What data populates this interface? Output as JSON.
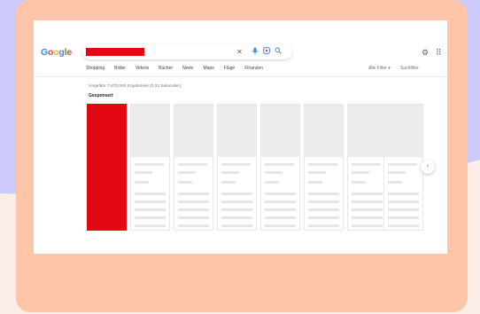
{
  "logo": {
    "letters": [
      "G",
      "o",
      "o",
      "g",
      "l",
      "e"
    ],
    "colors": [
      "#4285f4",
      "#ea4335",
      "#fbbc05",
      "#4285f4",
      "#34a853",
      "#ea4335"
    ]
  },
  "search": {
    "clear_icon": "close-icon",
    "mic_icon": "mic-icon",
    "lens_icon": "lens-icon",
    "search_icon": "search-icon"
  },
  "nav": {
    "items": [
      "Shopping",
      "Bilder",
      "Videos",
      "Bücher",
      "News",
      "Maps",
      "Flüge",
      "Finanzen"
    ],
    "filters_label": "Alle Filter",
    "tools_label": "Suchfilter"
  },
  "results": {
    "count_text": "Ungefähr 7.870.000 Ergebnisse (0,34 Sekunden)",
    "sponsored_label": "Gesponsert"
  },
  "colors": {
    "accent_red": "#e30613",
    "frame": "#ffc5a8",
    "background": "#fbeee9",
    "lilac": "#ccc9fb"
  }
}
